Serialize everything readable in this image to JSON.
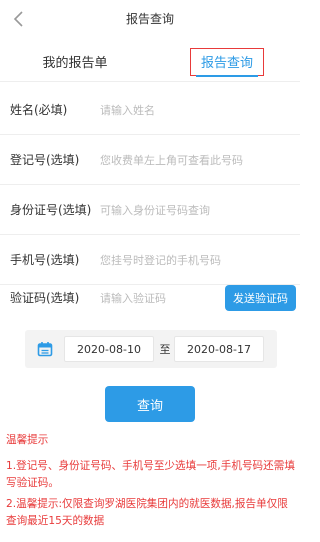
{
  "header": {
    "title": "报告查询"
  },
  "tabs": [
    {
      "label": "我的报告单"
    },
    {
      "label": "报告查询"
    }
  ],
  "form": {
    "fields": [
      {
        "label": "姓名(必填)",
        "placeholder": "请输入姓名"
      },
      {
        "label": "登记号(选填)",
        "placeholder": "您收费单左上角可查看此号码"
      },
      {
        "label": "身份证号(选填)",
        "placeholder": "可输入身份证号码查询"
      },
      {
        "label": "手机号(选填)",
        "placeholder": "您挂号时登记的手机号码"
      },
      {
        "label": "验证码(选填)",
        "placeholder": "请输入验证码"
      }
    ],
    "send_code_label": "发送验证码"
  },
  "date_range": {
    "start": "2020-08-10",
    "separator": "至",
    "end": "2020-08-17"
  },
  "query_button": "查询",
  "tips": {
    "title": "温馨提示",
    "items": [
      "1.登记号、身份证号码、手机号至少选填一项,手机号码还需填写验证码。",
      "2.温馨提示:仅限查询罗湖医院集团内的就医数据,报告单仅限查询最近15天的数据"
    ]
  },
  "colors": {
    "accent": "#2d9be6",
    "warning": "#e83a3a"
  },
  "icons": {
    "back": "chevron-left-icon",
    "calendar": "calendar-icon"
  }
}
